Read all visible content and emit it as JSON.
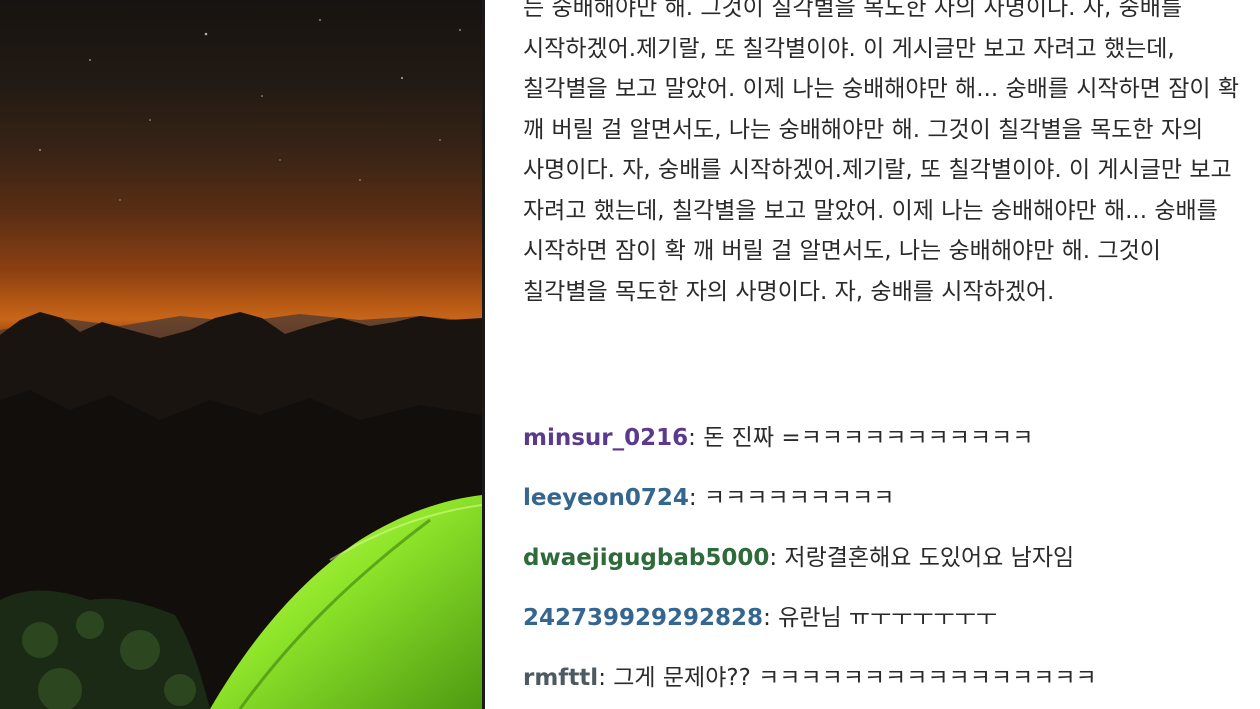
{
  "post": {
    "body": "는 숭배해야만 해. 그것이 칠각별을 목도한 자의 사명이다. 자, 숭배를 시작하겠어.제기랄, 또 칠각별이야. 이 게시글만 보고 자려고 했는데, 칠각별을 보고 말았어. 이제 나는 숭배해야만 해... 숭배를 시작하면 잠이 확 깨 버릴 걸 알면서도, 나는 숭배해야만 해. 그것이 칠각별을 목도한 자의 사명이다. 자, 숭배를 시작하겠어.제기랄, 또 칠각별이야. 이 게시글만 보고 자려고 했는데, 칠각별을 보고 말았어. 이제 나는 숭배해야만 해... 숭배를 시작하면 잠이 확 깨 버릴 걸 알면서도, 나는 숭배해야만 해. 그것이 칠각별을 목도한 자의 사명이다. 자, 숭배를 시작하겠어."
  },
  "comments": [
    {
      "username": "minsur_0216",
      "text": ": 돈 진짜 =ㅋㅋㅋㅋㅋㅋㅋㅋㅋㅋㅋ",
      "color": "#5b3a8e"
    },
    {
      "username": "leeyeon0724",
      "text": ": ㅋㅋㅋㅋㅋㅋㅋㅋㅋ",
      "color": "#34668f"
    },
    {
      "username": "dwaejigugbab5000",
      "text": ": 저랑결혼해요 도있어요 남자임",
      "color": "#2f6a3a"
    },
    {
      "username": "242739929292828",
      "text": ": 유란님 ㅠㅜㅜㅜㅜㅜㅜ",
      "color": "#34668f"
    },
    {
      "username": "rmfttl",
      "text": ": 그게 문제야?? ㅋㅋㅋㅋㅋㅋㅋㅋㅋㅋㅋㅋㅋㅋㅋㅋ",
      "color": "#4d5a62"
    }
  ],
  "photo": {
    "description_icon": "night-mountain-tent-photo"
  }
}
